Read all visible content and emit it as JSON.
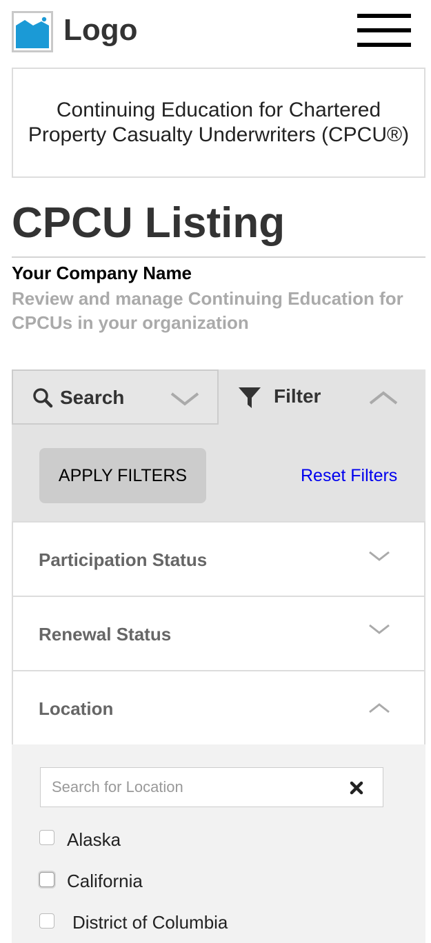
{
  "header": {
    "logo_text": "Logo",
    "logo_icon": "image-placeholder-icon",
    "menu_icon": "hamburger-menu-icon"
  },
  "banner": {
    "text": "Continuing Education for Chartered Property Casualty Underwriters (CPCU®)"
  },
  "page": {
    "title": "CPCU Listing",
    "company": "Your Company Name",
    "subtitle": "Review and manage Continuing Education for CPCUs in your organization"
  },
  "tabs": {
    "search": {
      "label": "Search",
      "icon": "search-icon",
      "state": "collapsed"
    },
    "filter": {
      "label": "Filter",
      "icon": "filter-icon",
      "state": "expanded"
    }
  },
  "filters": {
    "apply_label": "APPLY FILTERS",
    "reset_label": "Reset Filters",
    "sections": [
      {
        "label": "Participation Status",
        "state": "collapsed"
      },
      {
        "label": "Renewal Status",
        "state": "collapsed"
      },
      {
        "label": "Location",
        "state": "expanded"
      }
    ],
    "location": {
      "search_placeholder": "Search for Location",
      "search_value": "",
      "options": [
        {
          "label": "Alaska",
          "checked": false
        },
        {
          "label": "California",
          "checked": false
        },
        {
          "label": "District of Columbia",
          "checked": false
        }
      ]
    }
  },
  "colors": {
    "link": "#0000ee",
    "panel_bg": "#e3e3e3",
    "button_bg": "#cccccc",
    "subtitle": "#aaaaaa",
    "logo_blue": "#1b9ad6"
  }
}
